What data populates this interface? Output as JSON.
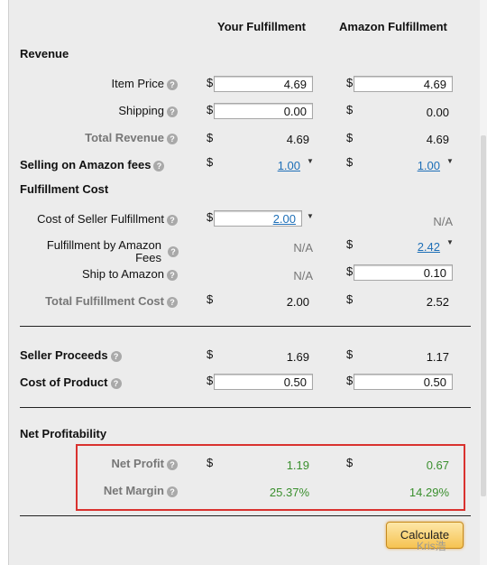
{
  "headers": {
    "your": "Your Fulfillment",
    "amazon": "Amazon Fulfillment"
  },
  "sections": {
    "revenue": "Revenue",
    "fulfillment": "Fulfillment Cost",
    "net": "Net Profitability"
  },
  "rows": {
    "item_price": {
      "label": "Item Price",
      "your": "4.69",
      "amazon": "4.69"
    },
    "shipping": {
      "label": "Shipping",
      "your": "0.00",
      "amazon": "0.00"
    },
    "total_revenue": {
      "label": "Total Revenue",
      "your": "4.69",
      "amazon": "4.69"
    },
    "selling_fees": {
      "label": "Selling on Amazon fees",
      "your": "1.00",
      "amazon": "1.00"
    },
    "cost_seller_fulfillment": {
      "label": "Cost of Seller Fulfillment",
      "your": "2.00",
      "amazon": "N/A"
    },
    "fba_fees": {
      "label_line1": "Fulfillment by Amazon",
      "label_line2": "Fees",
      "your": "N/A",
      "amazon": "2.42"
    },
    "ship_to_amazon": {
      "label": "Ship to Amazon",
      "your": "N/A",
      "amazon": "0.10"
    },
    "total_fulfillment": {
      "label": "Total Fulfillment Cost",
      "your": "2.00",
      "amazon": "2.52"
    },
    "seller_proceeds": {
      "label": "Seller Proceeds",
      "your": "1.69",
      "amazon": "1.17"
    },
    "cost_of_product": {
      "label": "Cost of Product",
      "your": "0.50",
      "amazon": "0.50"
    },
    "net_profit": {
      "label": "Net Profit",
      "your": "1.19",
      "amazon": "0.67"
    },
    "net_margin": {
      "label": "Net Margin",
      "your": "25.37%",
      "amazon": "14.29%"
    }
  },
  "currency_symbol": "$",
  "help_glyph": "?",
  "caret_glyph": "▼",
  "calculate_label": "Calculate",
  "watermark": "Kris浩",
  "colors": {
    "profit_green": "#3a8f2e",
    "highlight_red": "#d9322f",
    "link_blue": "#1e6fb7",
    "button_orange": "#f6c351"
  }
}
